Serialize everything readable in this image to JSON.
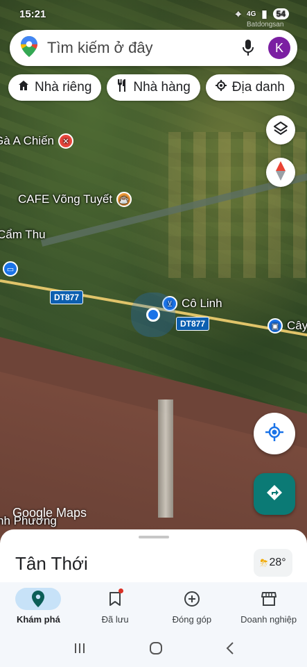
{
  "status_bar": {
    "time": "15:21",
    "battery": "54",
    "network": "4G"
  },
  "watermark": "Batdongsan",
  "search": {
    "placeholder": "Tìm kiếm ở đây",
    "avatar_letter": "K"
  },
  "chips": [
    {
      "icon": "home-icon",
      "label": "Nhà riêng"
    },
    {
      "icon": "restaurant-icon",
      "label": "Nhà hàng"
    },
    {
      "icon": "landmark-icon",
      "label": "Địa danh"
    }
  ],
  "map": {
    "pois": [
      {
        "label": "Gà A Chiến",
        "icon": "restaurant-icon",
        "color": "#e8453c"
      },
      {
        "label": "CAFE Võng Tuyết",
        "icon": "cafe-icon",
        "color": "#f29c3b"
      },
      {
        "label": "Cẩm Thu",
        "icon": "",
        "color": ""
      },
      {
        "label": "Cô Linh",
        "icon": "shopping-cart-icon",
        "color": "#1a73e8"
      },
      {
        "label": "Cây",
        "icon": "shopping-bag-icon",
        "color": "#1a73e8"
      },
      {
        "label": "nh Phương",
        "icon": "",
        "color": ""
      }
    ],
    "road_shields": [
      "DT877",
      "DT877"
    ],
    "google_logo": "Google Maps"
  },
  "bottom_sheet": {
    "place_name": "Tân Thới",
    "weather_temp": "28°",
    "weather_icon": "thunderstorm-icon"
  },
  "bottom_nav": [
    {
      "icon": "explore-pin-icon",
      "label": "Khám phá",
      "active": true
    },
    {
      "icon": "bookmark-icon",
      "label": "Đã lưu",
      "active": false
    },
    {
      "icon": "add-circle-icon",
      "label": "Đóng góp",
      "active": false
    },
    {
      "icon": "store-icon",
      "label": "Doanh nghiệp",
      "active": false
    }
  ],
  "colors": {
    "accent": "#1a73e8",
    "nav_active_bg": "#c7e2f8",
    "directions_btn": "#0b7a75"
  }
}
